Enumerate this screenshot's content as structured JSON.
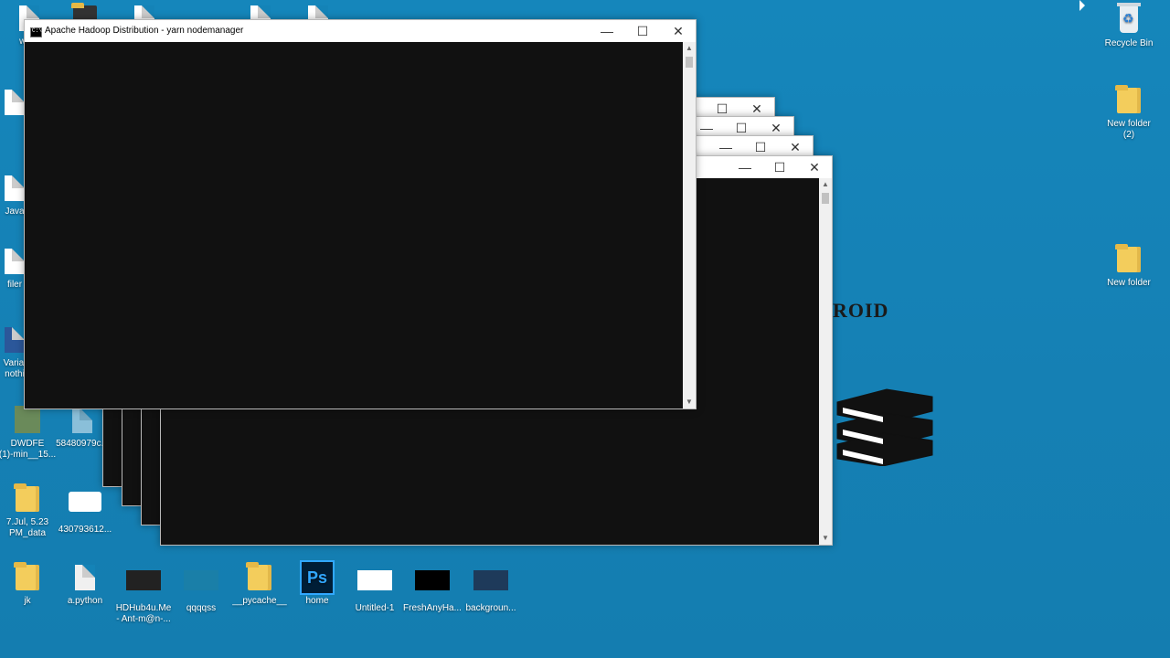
{
  "desktop": {
    "icons_left": [
      {
        "name": "wordpad-icon",
        "label": "word"
      },
      {
        "name": "java-icon",
        "label": "Java"
      },
      {
        "name": "files-icon",
        "label": "filer"
      },
      {
        "name": "word-doc-icon",
        "label": "Varial\nnothi"
      },
      {
        "name": "photo-icon",
        "label": "DWDFE\n(1)-min__15..."
      },
      {
        "name": "java-file-icon",
        "label": "58480979c..."
      },
      {
        "name": "folder-icon",
        "label": "7.Jul, 5.23\nPM_data"
      },
      {
        "name": "infinity-icon",
        "label": "430793612..."
      },
      {
        "name": "jk-folder-icon",
        "label": "jk"
      },
      {
        "name": "python-icon",
        "label": "a.python"
      },
      {
        "name": "video-icon",
        "label": "HDHub4u.Me\n- Ant-m@n-..."
      },
      {
        "name": "image-icon",
        "label": "qqqqss"
      },
      {
        "name": "pycache-folder-icon",
        "label": "__pycache__"
      },
      {
        "name": "photoshop-icon",
        "label": "home"
      },
      {
        "name": "untitled-icon",
        "label": "Untitled-1"
      },
      {
        "name": "freshany-icon",
        "label": "FreshAnyHa..."
      },
      {
        "name": "background-icon",
        "label": "backgroun..."
      }
    ],
    "icons_right": [
      {
        "name": "recycle-bin-icon",
        "label": "Recycle Bin"
      },
      {
        "name": "new-folder-2-icon",
        "label": "New folder\n(2)"
      },
      {
        "name": "new-folder-icon",
        "label": "New folder"
      }
    ],
    "wallpaper_text": "ROID",
    "photoshop_glyph": "Ps"
  },
  "window_main": {
    "title": "Apache Hadoop Distribution - yarn   nodemanager",
    "minimize": "—",
    "maximize": "☐",
    "close": "✕"
  },
  "back_windows": [
    {
      "minimize": "—",
      "maximize": "☐",
      "close": "✕"
    },
    {
      "minimize": "—",
      "maximize": "☐",
      "close": "✕"
    },
    {
      "minimize": "—",
      "maximize": "☐",
      "close": "✕"
    },
    {
      "minimize": "—",
      "maximize": "☐",
      "close": "✕"
    }
  ]
}
